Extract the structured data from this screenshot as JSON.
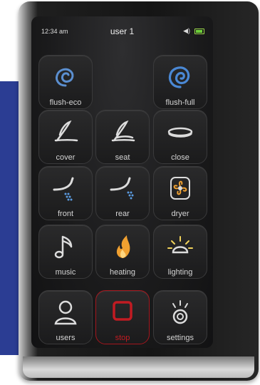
{
  "status": {
    "time": "12:34 am",
    "user": "user 1",
    "volume_icon": "speaker-icon",
    "battery_icon": "battery-icon"
  },
  "buttons": {
    "flush_eco": {
      "label": "flush-eco",
      "icon": "swirl-icon"
    },
    "flush_full": {
      "label": "flush-full",
      "icon": "swirl-icon"
    },
    "cover": {
      "label": "cover",
      "icon": "lid-icon"
    },
    "seat": {
      "label": "seat",
      "icon": "seat-icon"
    },
    "close": {
      "label": "close",
      "icon": "close-lid-icon"
    },
    "front": {
      "label": "front",
      "icon": "front-wash-icon"
    },
    "rear": {
      "label": "rear",
      "icon": "rear-wash-icon"
    },
    "dryer": {
      "label": "dryer",
      "icon": "fan-icon"
    },
    "music": {
      "label": "music",
      "icon": "music-note-icon"
    },
    "heating": {
      "label": "heating",
      "icon": "flame-icon"
    },
    "lighting": {
      "label": "lighting",
      "icon": "light-icon"
    },
    "users": {
      "label": "users",
      "icon": "user-icon"
    },
    "stop": {
      "label": "stop",
      "icon": "stop-icon"
    },
    "settings": {
      "label": "settings",
      "icon": "settings-icon"
    }
  },
  "colors": {
    "blue_accent": "#4a8fd8",
    "stop_red": "#c11b22",
    "flame_orange": "#f0a030",
    "light_yellow": "#f2d35a",
    "water_blue": "#5b9be0"
  }
}
